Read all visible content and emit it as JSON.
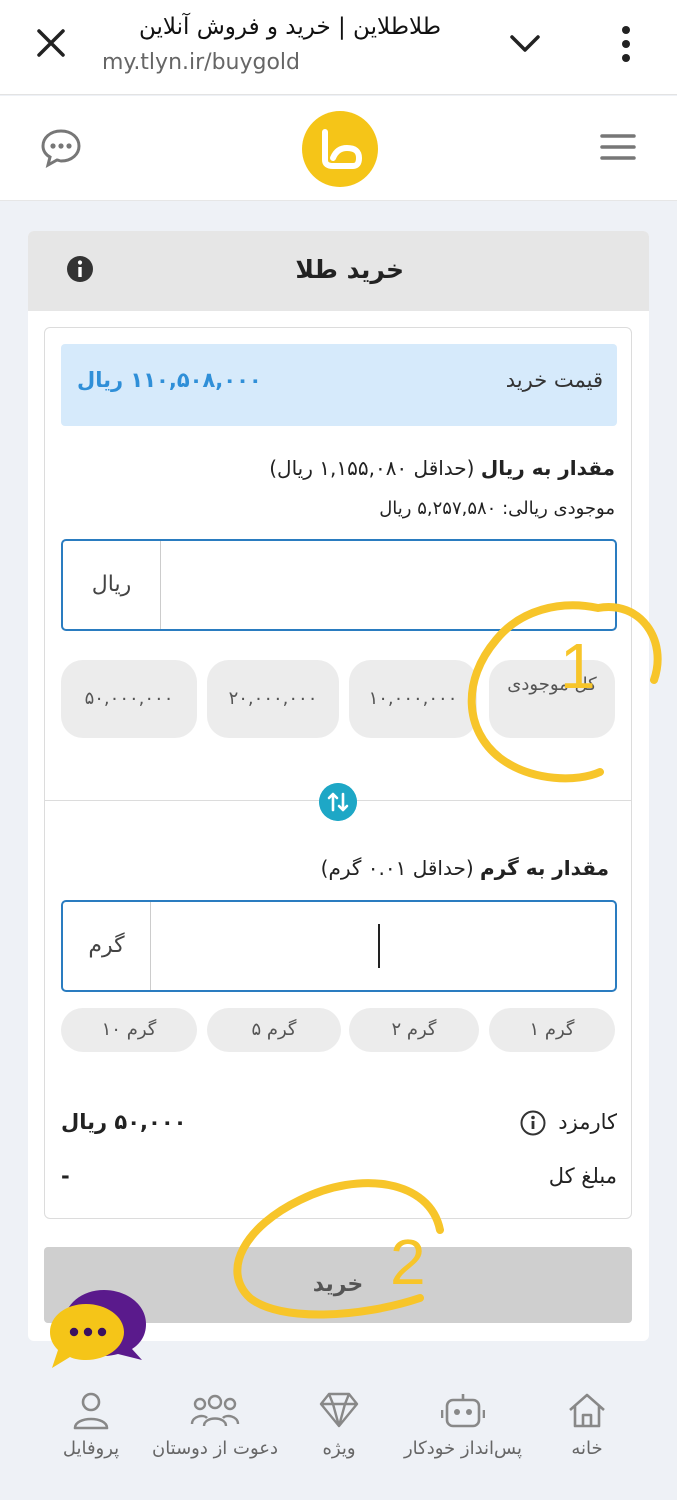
{
  "browser": {
    "title": "طلاطلاین | خرید و فروش آنلاین",
    "url": "my.tlyn.ir/buygold"
  },
  "card": {
    "title": "خرید طلا"
  },
  "price": {
    "label": "قیمت خرید",
    "value": "۱۱۰,۵۰۸,۰۰۰ ریال"
  },
  "rial_section": {
    "label_bold": "مقدار به ریال",
    "label_note": "(حداقل ۱,۱۵۵,۰۸۰ ریال)",
    "balance": "موجودی ریالی: ۵,۲۵۷,۵۸۰ ریال",
    "unit": "ریال",
    "value": "",
    "chips": [
      "کل موجودی",
      "۱۰,۰۰۰,۰۰۰",
      "۲۰,۰۰۰,۰۰۰",
      "۵۰,۰۰۰,۰۰۰"
    ]
  },
  "gram_section": {
    "label_bold": "مقدار به گرم",
    "label_note": "(حداقل ۰.۰۱ گرم)",
    "unit": "گرم",
    "value": "",
    "chips": [
      "۱ گرم",
      "۲ گرم",
      "۵ گرم",
      "۱۰ گرم"
    ]
  },
  "fee": {
    "label": "کارمزد",
    "value": "۵۰,۰۰۰ ریال"
  },
  "total": {
    "label": "مبلغ کل",
    "value": "-"
  },
  "buy_button": "خرید",
  "annotations": [
    "1",
    "2"
  ],
  "bottom_nav": [
    {
      "label": "خانه",
      "icon": "home-icon"
    },
    {
      "label": "پس‌انداز خودکار",
      "icon": "robot-icon"
    },
    {
      "label": "ویژه",
      "icon": "diamond-icon"
    },
    {
      "label": "دعوت از دوستان",
      "icon": "people-icon"
    },
    {
      "label": "پروفایل",
      "icon": "user-icon"
    }
  ],
  "colors": {
    "accent_blue": "#2a7cc0",
    "price_bg": "#d6eafb",
    "price_text": "#2f8fd8",
    "logo_yellow": "#f5c518",
    "swap_teal": "#1ea7c6",
    "annotation_yellow": "#f7c52a"
  }
}
